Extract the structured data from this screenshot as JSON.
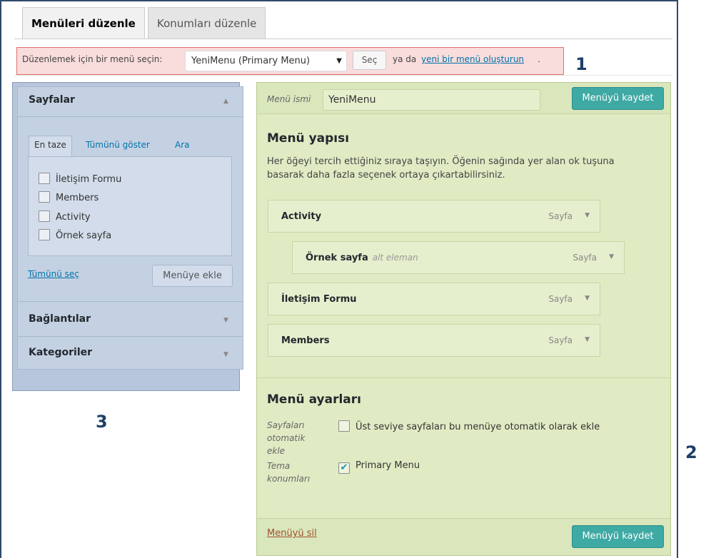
{
  "tabs": [
    {
      "label": "Menüleri düzenle",
      "active": true
    },
    {
      "label": "Konumları düzenle",
      "active": false
    }
  ],
  "select_bar": {
    "label": "Düzenlemek için bir menü seçin:",
    "selected_menu": "YeniMenu (Primary Menu)",
    "select_button": "Seç",
    "or_text": "ya da",
    "create_link": "yeni bir menü oluşturun",
    "period": "."
  },
  "markers": {
    "one": "1",
    "two": "2",
    "three": "3"
  },
  "left_panel": {
    "pages_title": "Sayfalar",
    "inner_tabs": [
      "En taze",
      "Tümünü göster",
      "Ara"
    ],
    "pages": [
      "İletişim Formu",
      "Members",
      "Activity",
      "Örnek sayfa"
    ],
    "select_all": "Tümünü seç",
    "add_button": "Menüye ekle",
    "links_title": "Bağlantılar",
    "categories_title": "Kategoriler"
  },
  "right_panel": {
    "name_label": "Menü ismi",
    "name_value": "YeniMenu",
    "save_button": "Menüyü kaydet",
    "structure_title": "Menü yapısı",
    "structure_desc": "Her öğeyi tercih ettiğiniz sıraya taşıyın. Öğenin sağında yer alan ok tuşuna basarak daha fazla seçenek ortaya çıkartabilirsiniz.",
    "items": [
      {
        "title": "Activity",
        "sub": "",
        "type": "Sayfa"
      },
      {
        "title": "Örnek sayfa",
        "sub": "alt eleman",
        "type": "Sayfa"
      },
      {
        "title": "İletişim Formu",
        "sub": "",
        "type": "Sayfa"
      },
      {
        "title": "Members",
        "sub": "",
        "type": "Sayfa"
      }
    ],
    "settings_title": "Menü ayarları",
    "auto_add_label": "Sayfaları otomatik ekle",
    "auto_add_text": "Üst seviye sayfaları bu menüye otomatik olarak ekle",
    "theme_label": "Tema konumları",
    "theme_option": "Primary Menu",
    "delete_link": "Menüyü sil"
  },
  "colors": {
    "highlight_red": "#f9dcdc",
    "highlight_blue": "#b7c6dc",
    "highlight_green": "#e0ebc4",
    "primary_button": "#3fa9a4",
    "link": "#0073aa"
  }
}
